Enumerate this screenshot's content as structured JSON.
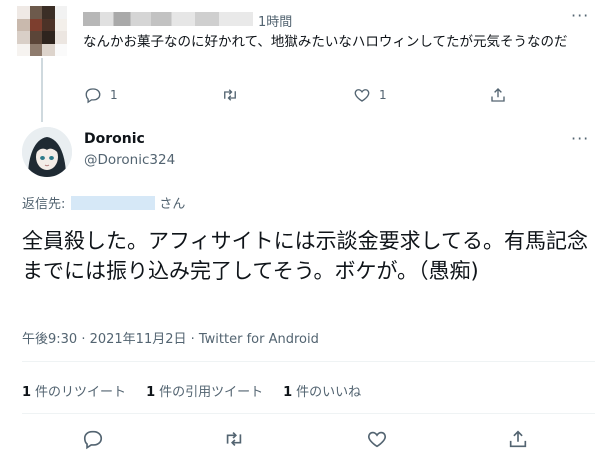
{
  "reply_tweet": {
    "time": "1時間",
    "text": "なんかお菓子なのに好かれて、地獄みたいなハロウィンしてたが元気そうなのだ",
    "more": "···",
    "actions": {
      "reply_count": "1",
      "like_count": "1"
    },
    "avatar_colors": [
      "#efe9e5",
      "#6d5a4c",
      "#3b2e26",
      "#f2f2f2",
      "#c9b9ad",
      "#7d3e2e",
      "#4c3227",
      "#f3efea",
      "#d9cfc7",
      "#5b4538",
      "#2e241e",
      "#ece6e1",
      "#f6f3f0",
      "#8e7b6d",
      "#ddd4cc",
      "#fafafa"
    ]
  },
  "main_tweet": {
    "display_name": "Doronic",
    "handle": "@Doronic324",
    "more": "···",
    "reply_to_label": "返信先:",
    "reply_to_suffix": "さん",
    "text": "全員殺した。アフィサイトには示談金要求してる。有馬記念までには振り込み完了してそう。ボケが。（愚痴)",
    "meta": "午後9:30 · 2021年11月2日 · Twitter for Android",
    "stats": {
      "retweets_count": "1",
      "retweets_label": "件のリツイート",
      "quotes_count": "1",
      "quotes_label": "件の引用ツイート",
      "likes_count": "1",
      "likes_label": "件のいいね"
    }
  },
  "colors": {
    "text": "#0f1419",
    "muted": "#536471",
    "divider": "#eff3f4"
  }
}
